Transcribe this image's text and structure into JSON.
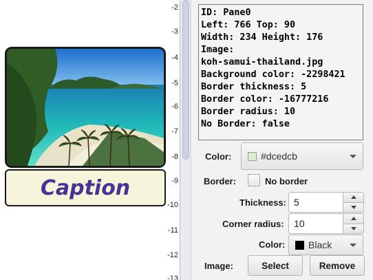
{
  "canvas": {
    "caption": "Caption"
  },
  "ruler": {
    "ticks": [
      "-2",
      "-3",
      "-4",
      "-5",
      "-6",
      "-7",
      "-8",
      "-9",
      "-10",
      "-11",
      "-12",
      "-13"
    ]
  },
  "info": {
    "lines": [
      "ID: Pane0",
      "Left: 766 Top: 90",
      "Width: 234 Height: 176",
      "Image:",
      "koh-samui-thailand.jpg",
      "Background color: -2298421",
      "Border thickness: 5",
      "Border color: -16777216",
      "Border radius: 10",
      "No Border: false"
    ]
  },
  "form": {
    "color_label": "Color:",
    "color_value": "#dcedcb",
    "color_swatch": "#dcedcb",
    "border_label": "Border:",
    "no_border_label": "No border",
    "thickness_label": "Thickness:",
    "thickness_value": "5",
    "corner_label": "Corner radius:",
    "corner_value": "10",
    "border_color_label": "Color:",
    "border_color_value": "Black",
    "border_color_swatch": "#000000",
    "image_label": "Image:",
    "select_button": "Select",
    "remove_button": "Remove"
  }
}
